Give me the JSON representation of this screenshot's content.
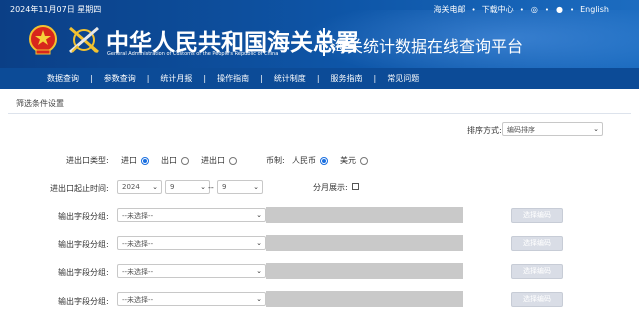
{
  "header": {
    "date": "2024年11月07日 星期四",
    "top_links": [
      "海关电邮",
      "下载中心",
      "English"
    ],
    "title_cn": "中华人民共和国海关总署",
    "title_en": "General Administration of Customs of the People's Republic of China",
    "platform": "海关统计数据在线查询平台"
  },
  "nav": [
    "数据查询",
    "参数查询",
    "统计月报",
    "操作指南",
    "统计制度",
    "服务指南",
    "常见问题"
  ],
  "filter": {
    "section_title": "筛选条件设置",
    "sort_label": "排序方式:",
    "sort_value": "编码排序",
    "trade_type_label": "进出口类型:",
    "trade_options": [
      {
        "label": "进口",
        "checked": true
      },
      {
        "label": "出口",
        "checked": false
      },
      {
        "label": "进出口",
        "checked": false
      }
    ],
    "currency_label": "币制:",
    "currency_options": [
      {
        "label": "人民币",
        "checked": true
      },
      {
        "label": "美元",
        "checked": false
      }
    ],
    "period_label": "进出口起止时间:",
    "year": "2024",
    "month_start": "9",
    "range_sep": "--",
    "month_end": "9",
    "monthly_label": "分月展示:",
    "group_rows": [
      {
        "label": "输出字段分组:",
        "placeholder": "--未选择--",
        "button": "选择编码"
      },
      {
        "label": "输出字段分组:",
        "placeholder": "--未选择--",
        "button": "选择编码"
      },
      {
        "label": "输出字段分组:",
        "placeholder": "--未选择--",
        "button": "选择编码"
      },
      {
        "label": "输出字段分组:",
        "placeholder": "--未选择--",
        "button": "选择编码"
      }
    ]
  }
}
